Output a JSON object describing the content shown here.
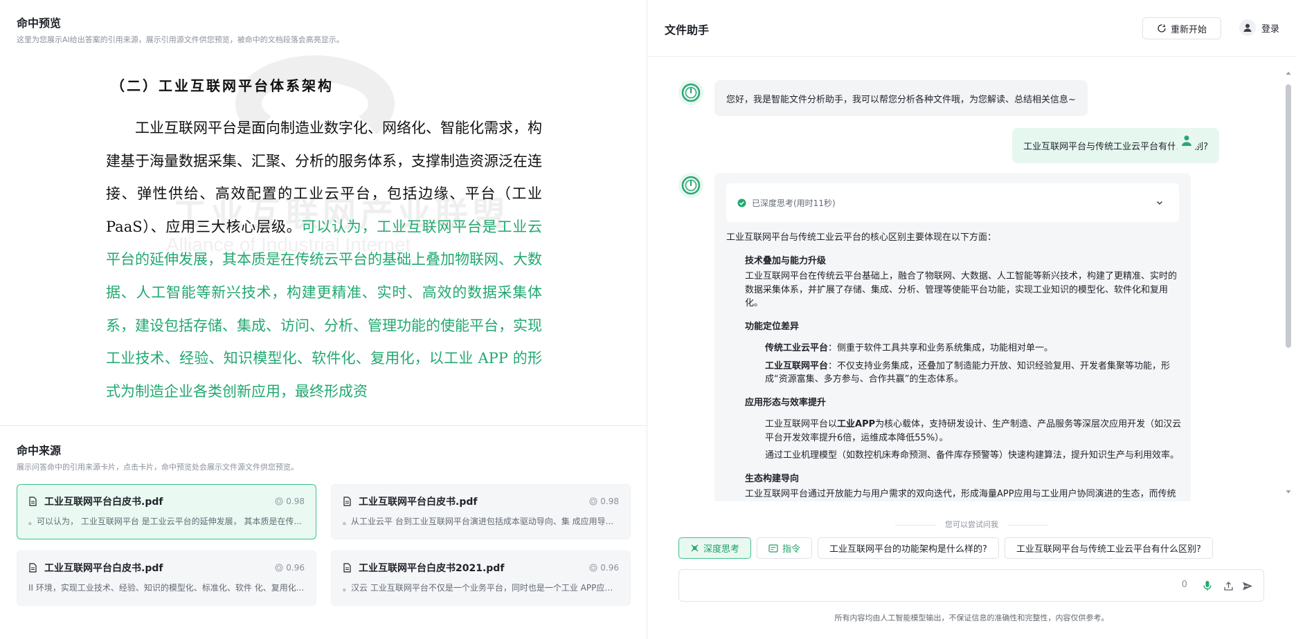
{
  "preview": {
    "title": "命中预览",
    "desc": "这里为您展示AI给出答案的引用来源，展示引用源文件供您预览，被命中的文档段落会高亮显示。",
    "doc_heading": "（二）工业互联网平台体系架构",
    "doc_normal": "工业互联网平台是面向制造业数字化、网络化、智能化需求，构建基于海量数据采集、汇聚、分析的服务体系，支撑制造资源泛在连接、弹性供给、高效配置的工业云平台，包括边缘、平台（工业 PaaS）、应用三大核心层级。",
    "doc_highlight": "可以认为，工业互联网平台是工业云平台的延伸发展，其本质是在传统云平台的基础上叠加物联网、大数据、人工智能等新兴技术，构建更精准、实时、高效的数据采集体系，建设包括存储、集成、访问、分析、管理功能的使能平台，实现工业技术、经验、知识模型化、软件化、复用化，以工业 APP 的形式为制造企业各类创新应用，最终形成资",
    "watermark_cn": "工业互联网产业联盟",
    "watermark_en": "Alliance of Industrial Internet"
  },
  "sources": {
    "title": "命中来源",
    "desc": "展示问答命中的引用来源卡片，点击卡片，命中预览处会展示文件源文件供您预览。",
    "cards": [
      {
        "name": "工业互联网平台白皮书.pdf",
        "score": "0.98",
        "snippet": "。可以认为， 工业互联网平台 是工业云平台的延伸发展， 其本质是在传...",
        "active": true
      },
      {
        "name": "工业互联网平台白皮书.pdf",
        "score": "0.98",
        "snippet": "。从工业云平 台到工业互联网平台演进包括成本驱动导向、集 成应用导...",
        "active": false
      },
      {
        "name": "工业互联网平台白皮书.pdf",
        "score": "0.96",
        "snippet": "II 环境，实现工业技术、经验、知识的模型化、标准化、软件 化、复用化...",
        "active": false
      },
      {
        "name": "工业互联网平台白皮书2021.pdf",
        "score": "0.96",
        "snippet": "。汉云 工业互联网平台不仅是一个业务平台，同时也是一个工业 APP应用...",
        "active": false
      }
    ]
  },
  "assistant": {
    "title": "文件助手",
    "restart_label": "重新开始",
    "login_label": "登录",
    "greeting": "您好，我是智能文件分析助手，我可以帮您分析各种文件哦，为您解读、总结相关信息~",
    "user_question": "工业互联网平台与传统工业云平台有什么区别?",
    "thinking_status": "已深度思考(用时11秒)",
    "answer": {
      "intro": "工业互联网平台与传统工业云平台的核心区别主要体现在以下方面：",
      "s1_title": "技术叠加与能力升级",
      "s1_text": "工业互联网平台在传统云平台基础上，融合了物联网、大数据、人工智能等新兴技术，构建了更精准、实时的数据采集体系，并扩展了存储、集成、分析、管理等使能平台功能，实现工业知识的模型化、软件化和复用化。",
      "s2_title": "功能定位差异",
      "s2_a_label": "传统工业云平台",
      "s2_a_text": "：侧重于软件工具共享和业务系统集成，功能相对单一。",
      "s2_b_label": "工业互联网平台",
      "s2_b_text": "：不仅支持业务集成，还叠加了制造能力开放、知识经验复用、开发者集聚等功能，形成“资源富集、多方参与、合作共赢”的生态体系。",
      "s3_title": "应用形态与效率提升",
      "s3_a_pre": "工业互联网平台以",
      "s3_a_bold": "工业APP",
      "s3_a_post": "为核心载体，支持研发设计、生产制造、产品服务等深层次应用开发（如汉云平台开发效率提升6倍，运维成本降低55%）。",
      "s3_b": "通过工业机理模型（如数控机床寿命预测、备件库存预警等）快速构建算法，提升知识生产与利用效率。",
      "s4_title": "生态构建导向",
      "s4_text": "工业互联网平台通过开放能力与用户需求的双向迭代，形成海量APP应用与工业用户协同演进的生态，而传统云平台更偏向封闭式服务。"
    },
    "suggest_label": "您可以尝试问我",
    "chips": {
      "deep_think": "深度思考",
      "command": "指令",
      "q1": "工业互联网平台的功能架构是什么样的?",
      "q2": "工业互联网平台与传统工业云平台有什么区别?"
    },
    "input_count": "0",
    "footer_note": "所有内容均由人工智能模型输出，不保证信息的准确性和完整性，内容仅供参考。"
  },
  "colors": {
    "accent": "#22a870",
    "highlight_text": "#22a870",
    "active_card_border": "#3cc28a"
  },
  "icons": [
    "pdf-icon",
    "score-icon",
    "restart-icon",
    "user-icon",
    "bot-avatar-icon",
    "check-circle-icon",
    "chevron-down-icon",
    "deep-think-icon",
    "command-icon",
    "mic-icon",
    "upload-icon",
    "send-icon"
  ]
}
